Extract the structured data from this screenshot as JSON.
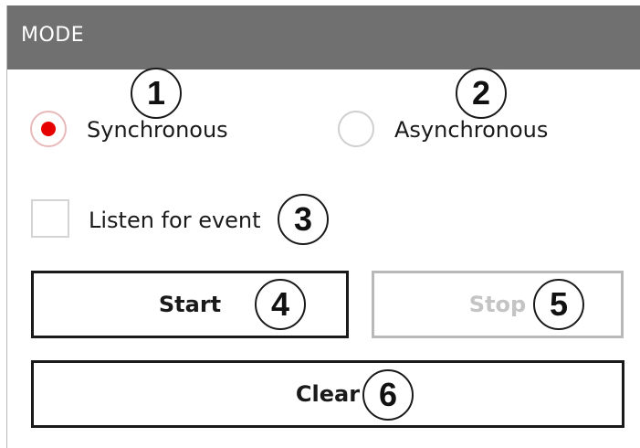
{
  "header": {
    "title": "MODE",
    "background": "#707070"
  },
  "mode": {
    "options": [
      {
        "label": "Synchronous",
        "selected": true
      },
      {
        "label": "Asynchronous",
        "selected": false
      }
    ],
    "accent": "#e60000"
  },
  "listen": {
    "label": "Listen for event",
    "checked": false
  },
  "buttons": {
    "start": "Start",
    "stop": "Stop",
    "clear": "Clear"
  },
  "callouts": [
    "1",
    "2",
    "3",
    "4",
    "5",
    "6"
  ]
}
